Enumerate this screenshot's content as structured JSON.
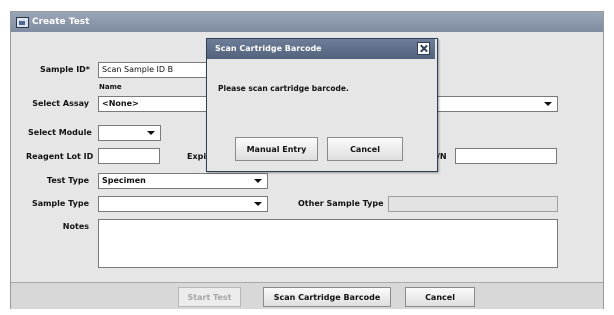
{
  "window": {
    "title": "Create Test"
  },
  "form": {
    "sample_id": {
      "label": "Sample ID*",
      "value": "Scan Sample ID B",
      "sublabel": "Name"
    },
    "select_assay": {
      "label": "Select Assay",
      "value": "<None>"
    },
    "select_module": {
      "label": "Select Module",
      "value": ""
    },
    "reagent_lot": {
      "label": "Reagent Lot ID",
      "value": ""
    },
    "expiration": {
      "label": "Expir"
    },
    "sn": {
      "label": "/N",
      "value": ""
    },
    "test_type": {
      "label": "Test Type",
      "value": "Specimen"
    },
    "sample_type": {
      "label": "Sample Type",
      "value": ""
    },
    "other_sample_type": {
      "label": "Other Sample Type",
      "value": ""
    },
    "notes": {
      "label": "Notes",
      "value": ""
    }
  },
  "buttons": {
    "start_test": "Start Test",
    "scan_cartridge": "Scan Cartridge Barcode",
    "cancel": "Cancel"
  },
  "dialog": {
    "title": "Scan Cartridge Barcode",
    "message": "Please scan cartridge barcode.",
    "manual_entry": "Manual Entry",
    "cancel": "Cancel"
  }
}
